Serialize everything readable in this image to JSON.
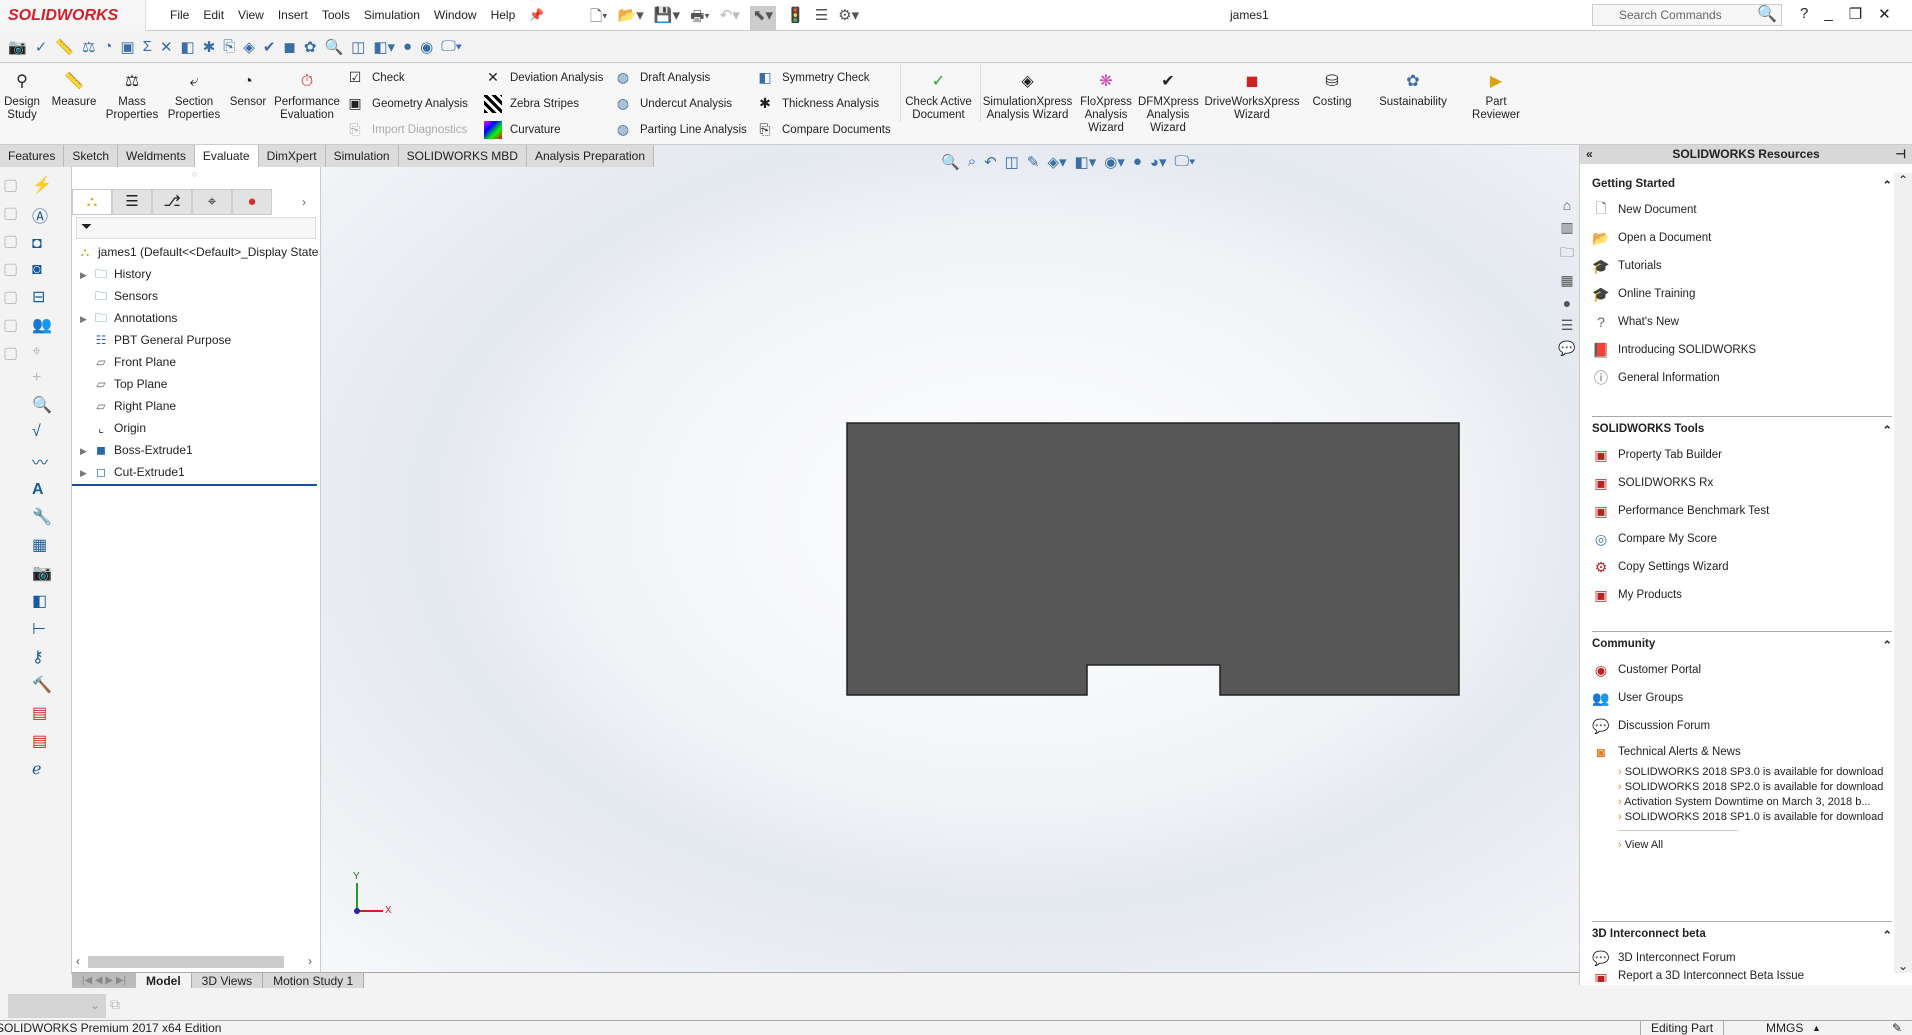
{
  "app": {
    "logo": "SOLIDWORKS",
    "document_title": "james1"
  },
  "menu": [
    "File",
    "Edit",
    "View",
    "Insert",
    "Tools",
    "Simulation",
    "Window",
    "Help"
  ],
  "search": {
    "placeholder": "Search Commands"
  },
  "ribbon": {
    "large": [
      {
        "label": "Design Study"
      },
      {
        "label": "Measure"
      },
      {
        "label": "Mass Properties"
      },
      {
        "label": "Section Properties"
      },
      {
        "label": "Sensor"
      },
      {
        "label": "Performance Evaluation"
      }
    ],
    "small": [
      {
        "label": "Check"
      },
      {
        "label": "Geometry Analysis"
      },
      {
        "label": "Import Diagnostics"
      },
      {
        "label": "Deviation Analysis"
      },
      {
        "label": "Zebra Stripes"
      },
      {
        "label": "Curvature"
      },
      {
        "label": "Draft Analysis"
      },
      {
        "label": "Undercut Analysis"
      },
      {
        "label": "Parting Line Analysis"
      },
      {
        "label": "Symmetry Check"
      },
      {
        "label": "Thickness Analysis"
      },
      {
        "label": "Compare Documents"
      }
    ],
    "large2": [
      {
        "label": "Check Active Document"
      },
      {
        "label": "SimulationXpress Analysis Wizard"
      },
      {
        "label": "FloXpress Analysis Wizard"
      },
      {
        "label": "DFMXpress Analysis Wizard"
      },
      {
        "label": "DriveWorksXpress Wizard"
      },
      {
        "label": "Costing"
      },
      {
        "label": "Sustainability"
      },
      {
        "label": "Part Reviewer"
      }
    ]
  },
  "tabs": [
    "Features",
    "Sketch",
    "Weldments",
    "Evaluate",
    "DimXpert",
    "Simulation",
    "SOLIDWORKS MBD",
    "Analysis Preparation"
  ],
  "active_tab": "Evaluate",
  "tree": {
    "root": "james1  (Default<<Default>_Display State",
    "nodes": [
      "History",
      "Sensors",
      "Annotations",
      "PBT General Purpose",
      "Front Plane",
      "Top Plane",
      "Right Plane",
      "Origin",
      "Boss-Extrude1",
      "Cut-Extrude1"
    ]
  },
  "bottom_tabs": [
    "Model",
    "3D Views",
    "Motion Study 1"
  ],
  "triad": {
    "x": "X",
    "y": "Y"
  },
  "resources": {
    "title": "SOLIDWORKS Resources",
    "getting_started": {
      "title": "Getting Started",
      "items": [
        "New Document",
        "Open a Document",
        "Tutorials",
        "Online Training",
        "What's New",
        "Introducing SOLIDWORKS",
        "General Information"
      ]
    },
    "tools": {
      "title": "SOLIDWORKS Tools",
      "items": [
        "Property Tab Builder",
        "SOLIDWORKS Rx",
        "Performance Benchmark Test",
        "Compare My Score",
        "Copy Settings Wizard",
        "My Products"
      ]
    },
    "community": {
      "title": "Community",
      "items": [
        "Customer Portal",
        "User Groups",
        "Discussion Forum",
        "Technical Alerts & News"
      ]
    },
    "news": [
      "SOLIDWORKS 2018 SP3.0 is available for download",
      "SOLIDWORKS 2018 SP2.0 is available for download",
      "Activation System Downtime on March 3, 2018 b...",
      "SOLIDWORKS 2018 SP1.0 is available for download"
    ],
    "view_all": "View All",
    "interconnect": {
      "title": "3D Interconnect beta",
      "items": [
        "3D Interconnect Forum",
        "Report a 3D Interconnect Beta Issue"
      ]
    }
  },
  "status": {
    "edition": "SOLIDWORKS Premium 2017 x64 Edition",
    "mode": "Editing Part",
    "units": "MMGS"
  }
}
